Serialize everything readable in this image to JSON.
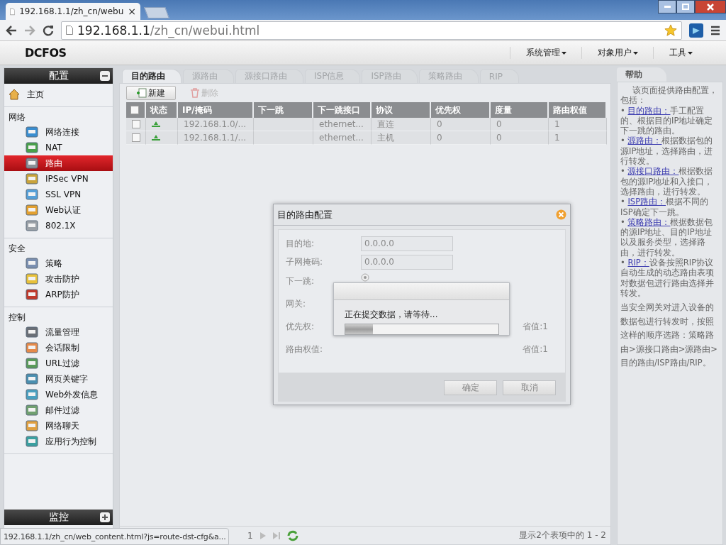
{
  "browser": {
    "tab_title": "192.168.1.1/zh_cn/webu",
    "tab_close": "×",
    "url_host": "192.168.1.1",
    "url_path": "/zh_cn/webui.html"
  },
  "app_header": {
    "logo": "DCFOS",
    "menus": [
      "系统管理",
      "对象用户",
      "工具"
    ]
  },
  "sidebar": {
    "title": "配置",
    "expanded": true,
    "home": "主页",
    "sections": [
      {
        "title": "网络",
        "items": [
          {
            "label": "网络连接",
            "selected": false
          },
          {
            "label": "NAT",
            "selected": false
          },
          {
            "label": "路由",
            "selected": true
          },
          {
            "label": "IPSec VPN",
            "selected": false
          },
          {
            "label": "SSL VPN",
            "selected": false
          },
          {
            "label": "Web认证",
            "selected": false
          },
          {
            "label": "802.1X",
            "selected": false
          }
        ]
      },
      {
        "title": "安全",
        "items": [
          {
            "label": "策略",
            "selected": false
          },
          {
            "label": "攻击防护",
            "selected": false
          },
          {
            "label": "ARP防护",
            "selected": false
          }
        ]
      },
      {
        "title": "控制",
        "items": [
          {
            "label": "流量管理",
            "selected": false
          },
          {
            "label": "会话限制",
            "selected": false
          },
          {
            "label": "URL过滤",
            "selected": false
          },
          {
            "label": "网页关键字",
            "selected": false
          },
          {
            "label": "Web外发信息",
            "selected": false
          },
          {
            "label": "邮件过滤",
            "selected": false
          },
          {
            "label": "网络聊天",
            "selected": false
          },
          {
            "label": "应用行为控制",
            "selected": false
          }
        ]
      }
    ],
    "bottom_panel": {
      "title": "监控",
      "expanded": false
    }
  },
  "tabs": [
    {
      "label": "目的路由",
      "selected": true
    },
    {
      "label": "源路由",
      "selected": false
    },
    {
      "label": "源接口路由",
      "selected": false
    },
    {
      "label": "ISP信息",
      "selected": false
    },
    {
      "label": "ISP路由",
      "selected": false
    },
    {
      "label": "策略路由",
      "selected": false
    },
    {
      "label": "RIP",
      "selected": false
    }
  ],
  "toolbar": [
    {
      "label": "新建",
      "disabled": false
    },
    {
      "label": "删除",
      "disabled": true
    }
  ],
  "table": {
    "all_checked": false,
    "columns": [
      "状态",
      "IP/掩码",
      "下一跳",
      "下一跳接口",
      "协议",
      "优先权",
      "度量",
      "路由权值"
    ],
    "rows": [
      {
        "checked": false,
        "cells": [
          "",
          "192.168.1.0/...",
          "",
          "ethernet...",
          "直连",
          "0",
          "0",
          "1"
        ]
      },
      {
        "checked": false,
        "cells": [
          "",
          "192.168.1.1/...",
          "",
          "ethernet...",
          "主机",
          "0",
          "0",
          "1"
        ]
      }
    ]
  },
  "pagination": {
    "page": "1",
    "summary": "显示2个表项中的 1 - 2"
  },
  "status_url": "192.168.1.1/zh_cn/web_content.html?js=route-dst-cfg&a...",
  "dialog": {
    "title": "目的路由配置",
    "fields": [
      {
        "label": "目的地:",
        "value": "0.0.0.0"
      },
      {
        "label": "子网掩码:",
        "value": "0.0.0.0"
      }
    ],
    "labels": [
      "下一跳:",
      "网关:",
      "优先权:",
      "路由权值:"
    ],
    "hints": [
      "省值:1",
      "省值:1"
    ],
    "buttons": [
      "确定",
      "取消"
    ]
  },
  "progress": {
    "message": "正在提交数据，请等待...",
    "level": 0.18
  },
  "help": {
    "title": "帮助",
    "intro": "该页面提供路由配置，包括：",
    "items": [
      {
        "bullet": "•",
        "link": "目的路由：",
        "text": "手工配置的、根据目的IP地址确定下一跳的路由。"
      },
      {
        "bullet": "•",
        "link": "源路由：",
        "text": "根据数据包的源IP地址，选择路由，进行转发。"
      },
      {
        "bullet": "•",
        "link": "源接口路由：",
        "text": "根据数据包的源IP地址和入接口，选择路由，进行转发。"
      },
      {
        "bullet": "•",
        "link": "ISP路由：",
        "text": "根据不同的ISP确定下一跳。"
      },
      {
        "bullet": "•",
        "link": "策略路由：",
        "text": "根据数据包的源IP地址、目的IP地址以及服务类型，选择路由，进行转发。"
      },
      {
        "bullet": "•",
        "link": "RIP：",
        "text": "设备按照RIP协议自动生成的动态路由表项对数据包进行路由选择并转发。"
      }
    ],
    "outro": "当安全网关对进入设备的数据包进行转发时，按照这样的顺序选路：策略路由>源接口路由>源路由>目的路由/ISP路由/RIP。"
  }
}
